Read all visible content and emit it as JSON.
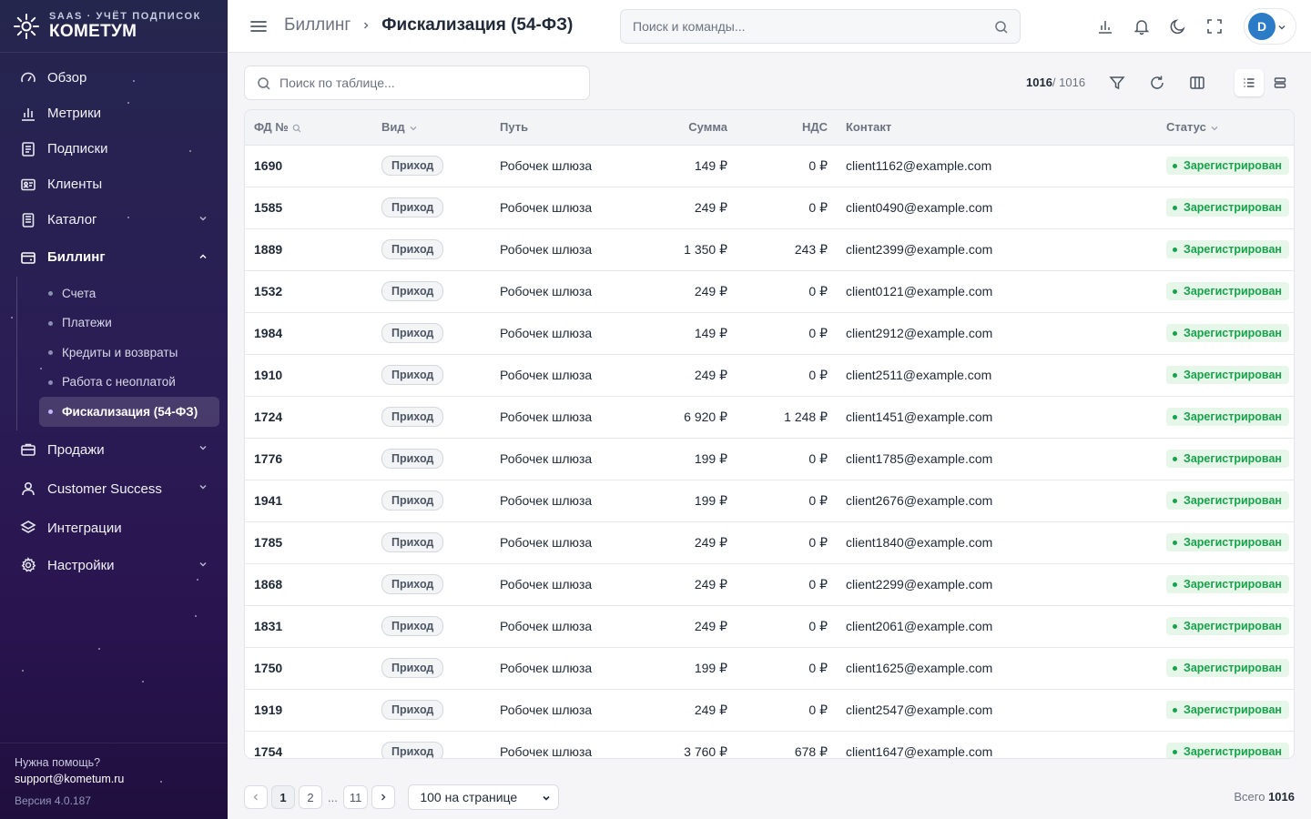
{
  "brand": {
    "subtitle": "SAAS · УЧЁТ ПОДПИСОК",
    "name": "КОМЕТУМ"
  },
  "sidebar": {
    "items": [
      {
        "label": "Обзор",
        "icon": "gauge-icon"
      },
      {
        "label": "Метрики",
        "icon": "bar-chart-icon"
      },
      {
        "label": "Подписки",
        "icon": "document-icon"
      },
      {
        "label": "Клиенты",
        "icon": "id-card-icon"
      },
      {
        "label": "Каталог",
        "icon": "catalog-icon"
      }
    ],
    "billing": {
      "label": "Биллинг",
      "icon": "wallet-icon",
      "children": [
        "Счета",
        "Платежи",
        "Кредиты и возвраты",
        "Работа с неоплатой",
        "Фискализация (54-ФЗ)"
      ]
    },
    "items_after": [
      {
        "label": "Продажи",
        "icon": "briefcase-icon"
      },
      {
        "label": "Customer Success",
        "icon": "user-icon"
      },
      {
        "label": "Интеграции",
        "icon": "layers-icon"
      },
      {
        "label": "Настройки",
        "icon": "gear-icon"
      }
    ],
    "footer": {
      "help": "Нужна помощь?",
      "email": "support@kometum.ru",
      "version": "Версия 4.0.187"
    }
  },
  "header": {
    "breadcrumb_parent": "Биллинг",
    "breadcrumb_current": "Фискализация (54-ФЗ)",
    "search_placeholder": "Поиск и команды...",
    "avatar_initial": "D"
  },
  "toolbar": {
    "table_search_placeholder": "Поиск по таблице...",
    "count_shown": "1016",
    "count_total": "/ 1016"
  },
  "table": {
    "columns": [
      "ФД №",
      "Вид",
      "Путь",
      "Сумма",
      "НДС",
      "Контакт",
      "Статус"
    ],
    "rows": [
      {
        "fd": "1690",
        "kind": "Приход",
        "path": "Робочек шлюза",
        "sum": "149 ₽",
        "vat": "0 ₽",
        "contact": "client1162@example.com",
        "status": "Зарегистрирован"
      },
      {
        "fd": "1585",
        "kind": "Приход",
        "path": "Робочек шлюза",
        "sum": "249 ₽",
        "vat": "0 ₽",
        "contact": "client0490@example.com",
        "status": "Зарегистрирован"
      },
      {
        "fd": "1889",
        "kind": "Приход",
        "path": "Робочек шлюза",
        "sum": "1 350 ₽",
        "vat": "243 ₽",
        "contact": "client2399@example.com",
        "status": "Зарегистрирован"
      },
      {
        "fd": "1532",
        "kind": "Приход",
        "path": "Робочек шлюза",
        "sum": "249 ₽",
        "vat": "0 ₽",
        "contact": "client0121@example.com",
        "status": "Зарегистрирован"
      },
      {
        "fd": "1984",
        "kind": "Приход",
        "path": "Робочек шлюза",
        "sum": "149 ₽",
        "vat": "0 ₽",
        "contact": "client2912@example.com",
        "status": "Зарегистрирован"
      },
      {
        "fd": "1910",
        "kind": "Приход",
        "path": "Робочек шлюза",
        "sum": "249 ₽",
        "vat": "0 ₽",
        "contact": "client2511@example.com",
        "status": "Зарегистрирован"
      },
      {
        "fd": "1724",
        "kind": "Приход",
        "path": "Робочек шлюза",
        "sum": "6 920 ₽",
        "vat": "1 248 ₽",
        "contact": "client1451@example.com",
        "status": "Зарегистрирован"
      },
      {
        "fd": "1776",
        "kind": "Приход",
        "path": "Робочек шлюза",
        "sum": "199 ₽",
        "vat": "0 ₽",
        "contact": "client1785@example.com",
        "status": "Зарегистрирован"
      },
      {
        "fd": "1941",
        "kind": "Приход",
        "path": "Робочек шлюза",
        "sum": "199 ₽",
        "vat": "0 ₽",
        "contact": "client2676@example.com",
        "status": "Зарегистрирован"
      },
      {
        "fd": "1785",
        "kind": "Приход",
        "path": "Робочек шлюза",
        "sum": "249 ₽",
        "vat": "0 ₽",
        "contact": "client1840@example.com",
        "status": "Зарегистрирован"
      },
      {
        "fd": "1868",
        "kind": "Приход",
        "path": "Робочек шлюза",
        "sum": "249 ₽",
        "vat": "0 ₽",
        "contact": "client2299@example.com",
        "status": "Зарегистрирован"
      },
      {
        "fd": "1831",
        "kind": "Приход",
        "path": "Робочек шлюза",
        "sum": "249 ₽",
        "vat": "0 ₽",
        "contact": "client2061@example.com",
        "status": "Зарегистрирован"
      },
      {
        "fd": "1750",
        "kind": "Приход",
        "path": "Робочек шлюза",
        "sum": "199 ₽",
        "vat": "0 ₽",
        "contact": "client1625@example.com",
        "status": "Зарегистрирован"
      },
      {
        "fd": "1919",
        "kind": "Приход",
        "path": "Робочек шлюза",
        "sum": "249 ₽",
        "vat": "0 ₽",
        "contact": "client2547@example.com",
        "status": "Зарегистрирован"
      },
      {
        "fd": "1754",
        "kind": "Приход",
        "path": "Робочек шлюза",
        "sum": "3 760 ₽",
        "vat": "678 ₽",
        "contact": "client1647@example.com",
        "status": "Зарегистрирован"
      }
    ]
  },
  "pagination": {
    "pages": [
      "1",
      "2",
      "11"
    ],
    "ellipsis": "...",
    "per_page": "100 на странице",
    "total_label": "Всего",
    "total_value": "1016"
  },
  "colors": {
    "status_green": "#16a34a",
    "accent_avatar": "#2b7bc6",
    "sidebar_bg": "#2a1d55"
  }
}
